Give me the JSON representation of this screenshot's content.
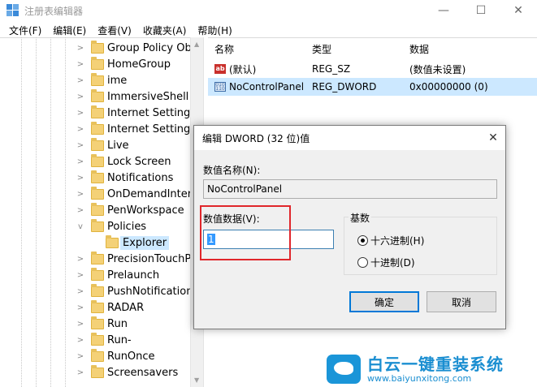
{
  "window": {
    "title": "注册表编辑器",
    "minimize_glyph": "—",
    "maximize_glyph": "☐",
    "close_glyph": "✕"
  },
  "menu": [
    {
      "label": "文件(F)"
    },
    {
      "label": "编辑(E)"
    },
    {
      "label": "查看(V)"
    },
    {
      "label": "收藏夹(A)"
    },
    {
      "label": "帮助(H)"
    }
  ],
  "tree": {
    "items": [
      {
        "label": "Group Policy Obje",
        "expander": ">"
      },
      {
        "label": "HomeGroup",
        "expander": ">"
      },
      {
        "label": "ime",
        "expander": ">"
      },
      {
        "label": "ImmersiveShell",
        "expander": ">"
      },
      {
        "label": "Internet Settings",
        "expander": ">"
      },
      {
        "label": "Internet SettingsV",
        "expander": ">"
      },
      {
        "label": "Live",
        "expander": ">"
      },
      {
        "label": "Lock Screen",
        "expander": ">"
      },
      {
        "label": "Notifications",
        "expander": ">"
      },
      {
        "label": "OnDemandInterfa",
        "expander": ">"
      },
      {
        "label": "PenWorkspace",
        "expander": ">"
      },
      {
        "label": "Policies",
        "expander": "v"
      },
      {
        "label": "Explorer",
        "expander": ""
      },
      {
        "label": "PrecisionTouchPa",
        "expander": ">"
      },
      {
        "label": "Prelaunch",
        "expander": ">"
      },
      {
        "label": "PushNotifications",
        "expander": ">"
      },
      {
        "label": "RADAR",
        "expander": ">"
      },
      {
        "label": "Run",
        "expander": ">"
      },
      {
        "label": "Run-",
        "expander": ">"
      },
      {
        "label": "RunOnce",
        "expander": ">"
      },
      {
        "label": "Screensavers",
        "expander": ">"
      }
    ],
    "scroll_up": "▲",
    "scroll_down": "▼"
  },
  "list": {
    "headers": {
      "name": "名称",
      "type": "类型",
      "data": "数据"
    },
    "rows": [
      {
        "icon": "ab",
        "name": "(默认)",
        "type": "REG_SZ",
        "data": "(数值未设置)"
      },
      {
        "icon": "010\n110",
        "name": "NoControlPanel",
        "type": "REG_DWORD",
        "data": "0x00000000 (0)"
      }
    ]
  },
  "dialog": {
    "title": "编辑 DWORD (32 位)值",
    "close_glyph": "✕",
    "name_label": "数值名称(N):",
    "name_value": "NoControlPanel",
    "data_label": "数值数据(V):",
    "data_value": "1",
    "base_label": "基数",
    "hex_label": "十六进制(H)",
    "dec_label": "十进制(D)",
    "ok_label": "确定",
    "cancel_label": "取消"
  },
  "watermark": {
    "brand": "白云一键重装系统",
    "url": "www.baiyunxitong.com"
  },
  "colors": {
    "accent": "#0078d7",
    "highlight": "#e0262b",
    "selection": "#cce8ff"
  }
}
